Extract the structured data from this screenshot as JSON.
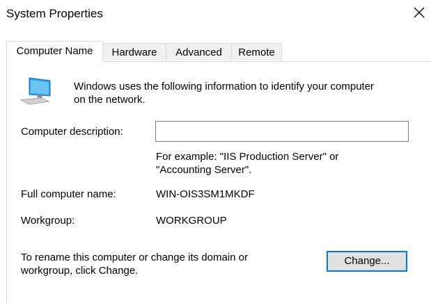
{
  "window": {
    "title": "System Properties"
  },
  "tabs": [
    {
      "label": "Computer Name",
      "active": true
    },
    {
      "label": "Hardware",
      "active": false
    },
    {
      "label": "Advanced",
      "active": false
    },
    {
      "label": "Remote",
      "active": false
    }
  ],
  "computer_name": {
    "intro_line1": "Windows uses the following information to identify your computer",
    "intro_line2": "on the network.",
    "description_label": "Computer description:",
    "description_value": "",
    "example_line1": "For example: \"IIS Production Server\" or",
    "example_line2": "\"Accounting Server\".",
    "full_name_label": "Full computer name:",
    "full_name_value": "WIN-OIS3SM1MKDF",
    "workgroup_label": "Workgroup:",
    "workgroup_value": "WORKGROUP",
    "rename_line1": "To rename this computer or change its domain or",
    "rename_line2": "workgroup, click Change.",
    "change_button": "Change..."
  },
  "icons": {
    "close": "close-icon",
    "computer": "computer-icon"
  },
  "colors": {
    "accent": "#0078d7",
    "border": "#d9d9d9",
    "tab_inactive": "#f0f0f0",
    "button_face": "#e1e1e1"
  }
}
